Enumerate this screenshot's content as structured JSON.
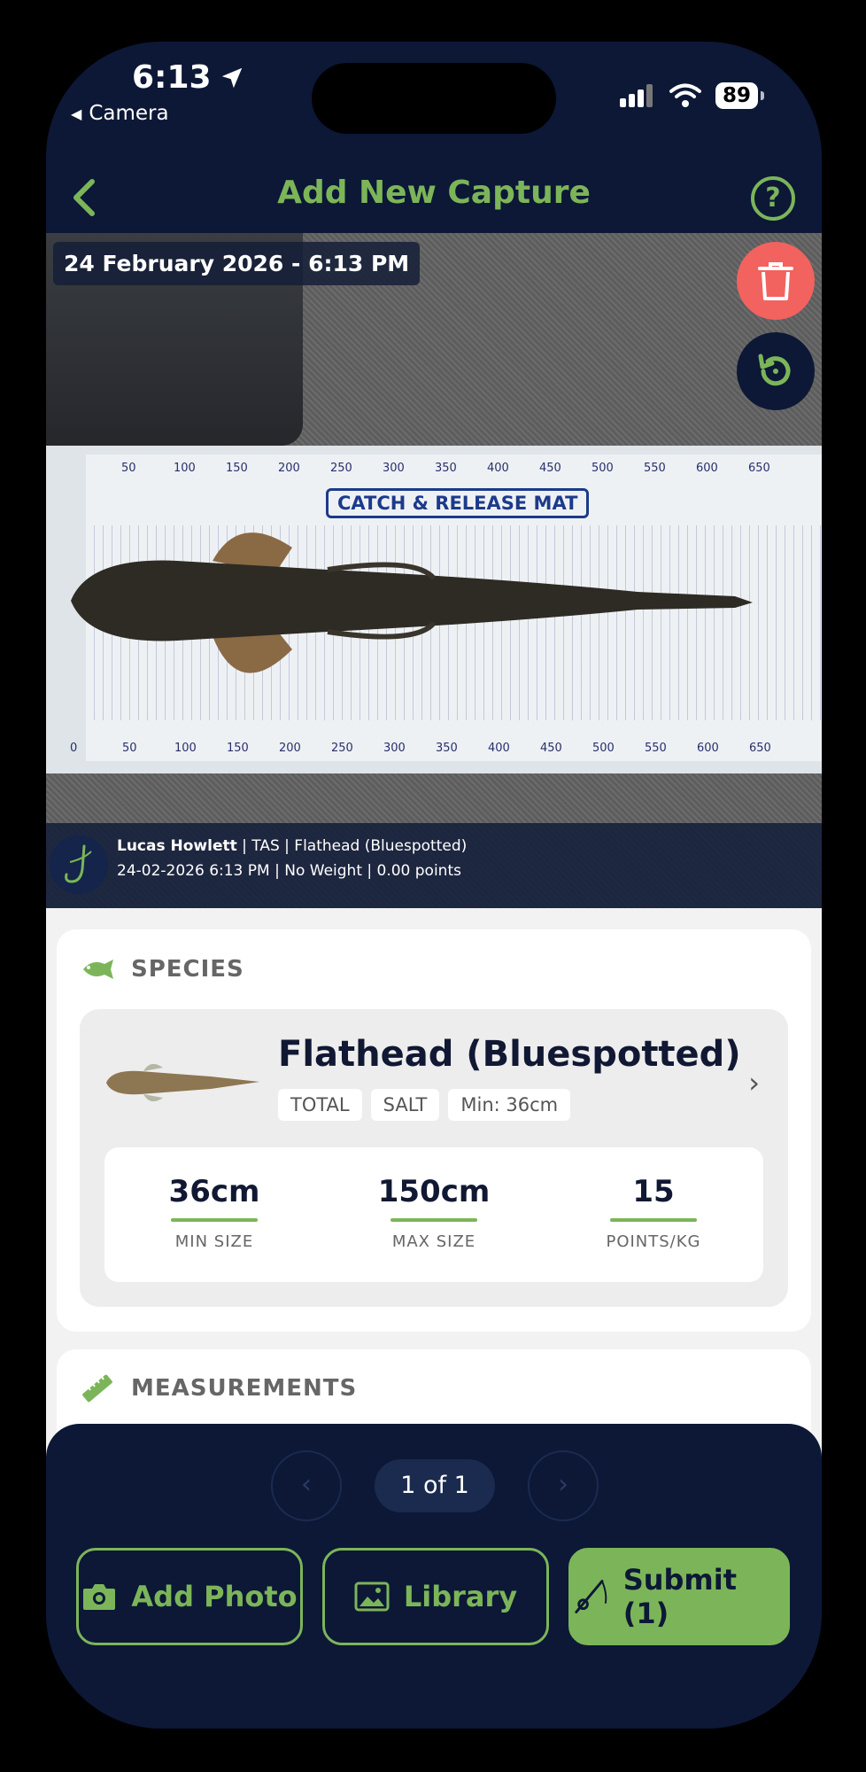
{
  "status_bar": {
    "time": "6:13",
    "back_app": "Camera",
    "battery": "89"
  },
  "header": {
    "title": "Add New Capture"
  },
  "photo": {
    "date_badge": "24 February 2026 - 6:13 PM",
    "mat_title": "CATCH & RELEASE MAT",
    "ruler_top": [
      "50",
      "100",
      "150",
      "200",
      "250",
      "300",
      "350",
      "400",
      "450",
      "500",
      "550",
      "600",
      "650"
    ],
    "ruler_bottom": [
      "0",
      "50",
      "100",
      "150",
      "200",
      "250",
      "300",
      "350",
      "400",
      "450",
      "500",
      "550",
      "600",
      "650"
    ],
    "caption": {
      "angler": "Lucas Howlett",
      "details": " | TAS | Flathead (Bluespotted)",
      "line2": "24-02-2026 6:13 PM | No Weight | 0.00 points"
    }
  },
  "species": {
    "section_label": "SPECIES",
    "name": "Flathead (Bluespotted)",
    "tags": [
      "TOTAL",
      "SALT",
      "Min: 36cm"
    ],
    "stats": [
      {
        "value": "36cm",
        "label": "MIN SIZE"
      },
      {
        "value": "150cm",
        "label": "MAX SIZE"
      },
      {
        "value": "15",
        "label": "POINTS/KG"
      }
    ]
  },
  "measurements": {
    "section_label": "MEASUREMENTS"
  },
  "pager": {
    "count": "1 of 1"
  },
  "actions": {
    "add_photo": "Add Photo",
    "library": "Library",
    "submit": "Submit (1)"
  },
  "colors": {
    "navy": "#0c1836",
    "accent_green": "#7cb559",
    "delete_red": "#f2625f"
  }
}
